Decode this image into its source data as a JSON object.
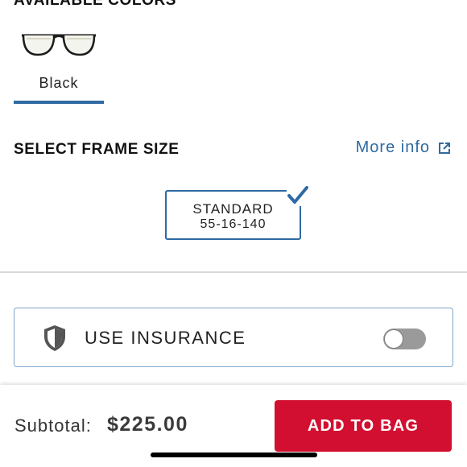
{
  "colors": {
    "heading": "AVAILABLE COLORS",
    "options": [
      {
        "label": "Black",
        "selected": true
      }
    ],
    "accent": "#2f6aa3"
  },
  "frame_size": {
    "heading": "SELECT FRAME SIZE",
    "more_info_label": "More info",
    "options": [
      {
        "name": "STANDARD",
        "dimensions": "55-16-140",
        "selected": true
      }
    ]
  },
  "insurance": {
    "label": "USE INSURANCE",
    "enabled": false
  },
  "footer": {
    "subtotal_label": "Subtotal:",
    "subtotal_value": "$225.00",
    "add_button_label": "ADD TO BAG",
    "button_color": "#d20f30"
  }
}
